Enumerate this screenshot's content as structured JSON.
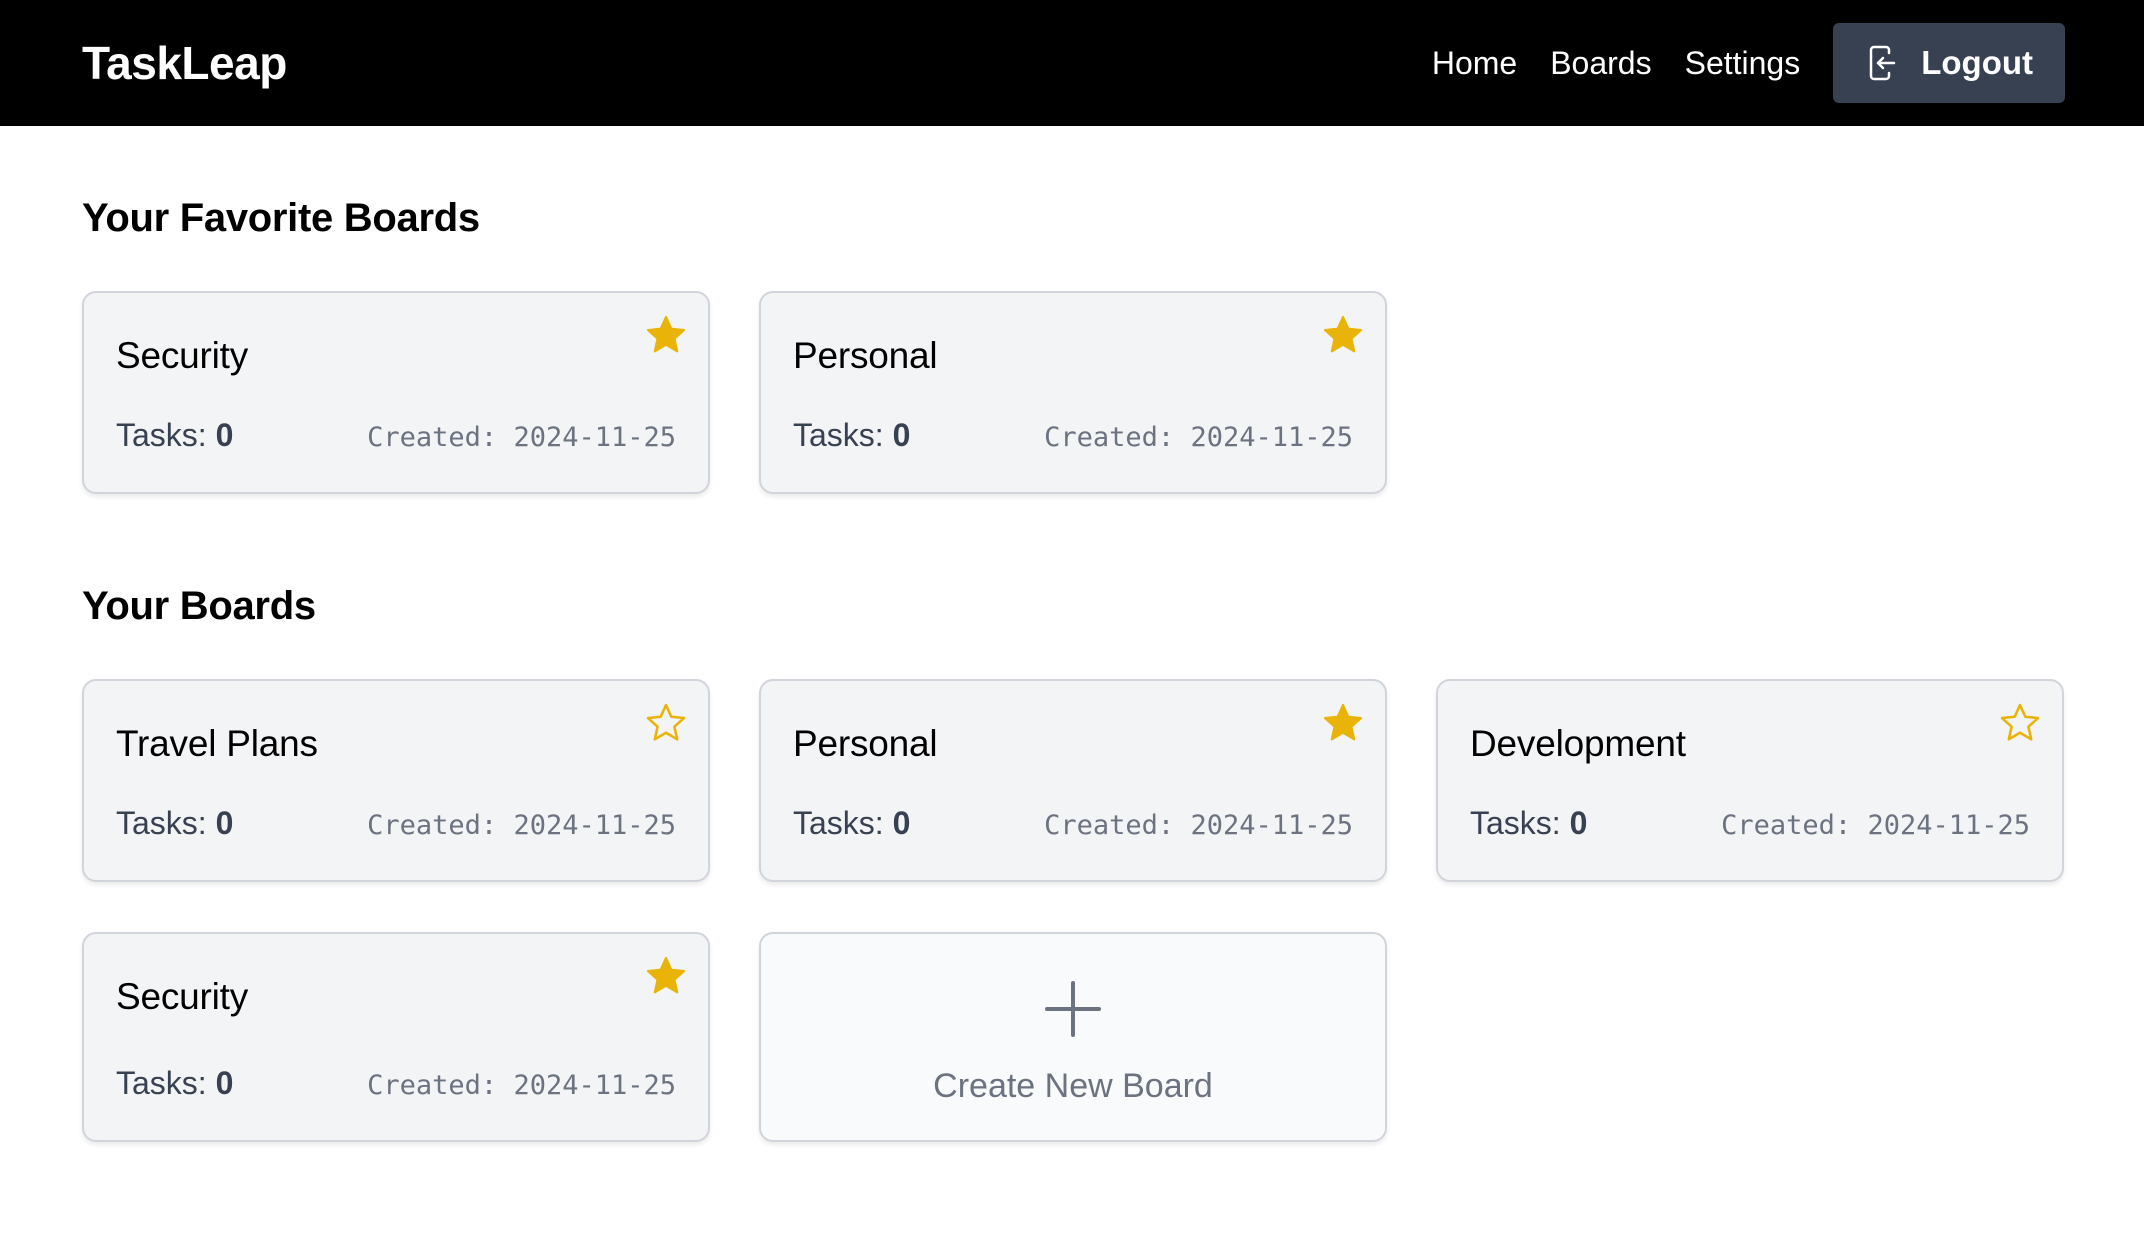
{
  "header": {
    "logo": "TaskLeap",
    "nav": [
      {
        "label": "Home"
      },
      {
        "label": "Boards"
      },
      {
        "label": "Settings"
      }
    ],
    "logout_label": "Logout",
    "logout_icon": "logout-icon"
  },
  "colors": {
    "header_bg": "#000000",
    "logout_bg": "#374151",
    "card_bg": "#f3f4f6",
    "card_border": "#d1d5db",
    "star": "#eab308",
    "muted_text": "#6b7280"
  },
  "favorites": {
    "title": "Your Favorite Boards",
    "boards": [
      {
        "name": "Security",
        "tasks_label": "Tasks:",
        "tasks": "0",
        "created": "Created: 2024-11-25",
        "favorite": true
      },
      {
        "name": "Personal",
        "tasks_label": "Tasks:",
        "tasks": "0",
        "created": "Created: 2024-11-25",
        "favorite": true
      }
    ]
  },
  "boards": {
    "title": "Your Boards",
    "items": [
      {
        "name": "Travel Plans",
        "tasks_label": "Tasks:",
        "tasks": "0",
        "created": "Created: 2024-11-25",
        "favorite": false
      },
      {
        "name": "Personal",
        "tasks_label": "Tasks:",
        "tasks": "0",
        "created": "Created: 2024-11-25",
        "favorite": true
      },
      {
        "name": "Development",
        "tasks_label": "Tasks:",
        "tasks": "0",
        "created": "Created: 2024-11-25",
        "favorite": false
      },
      {
        "name": "Security",
        "tasks_label": "Tasks:",
        "tasks": "0",
        "created": "Created: 2024-11-25",
        "favorite": true
      }
    ],
    "create_label": "Create New Board",
    "create_icon": "plus-icon"
  }
}
